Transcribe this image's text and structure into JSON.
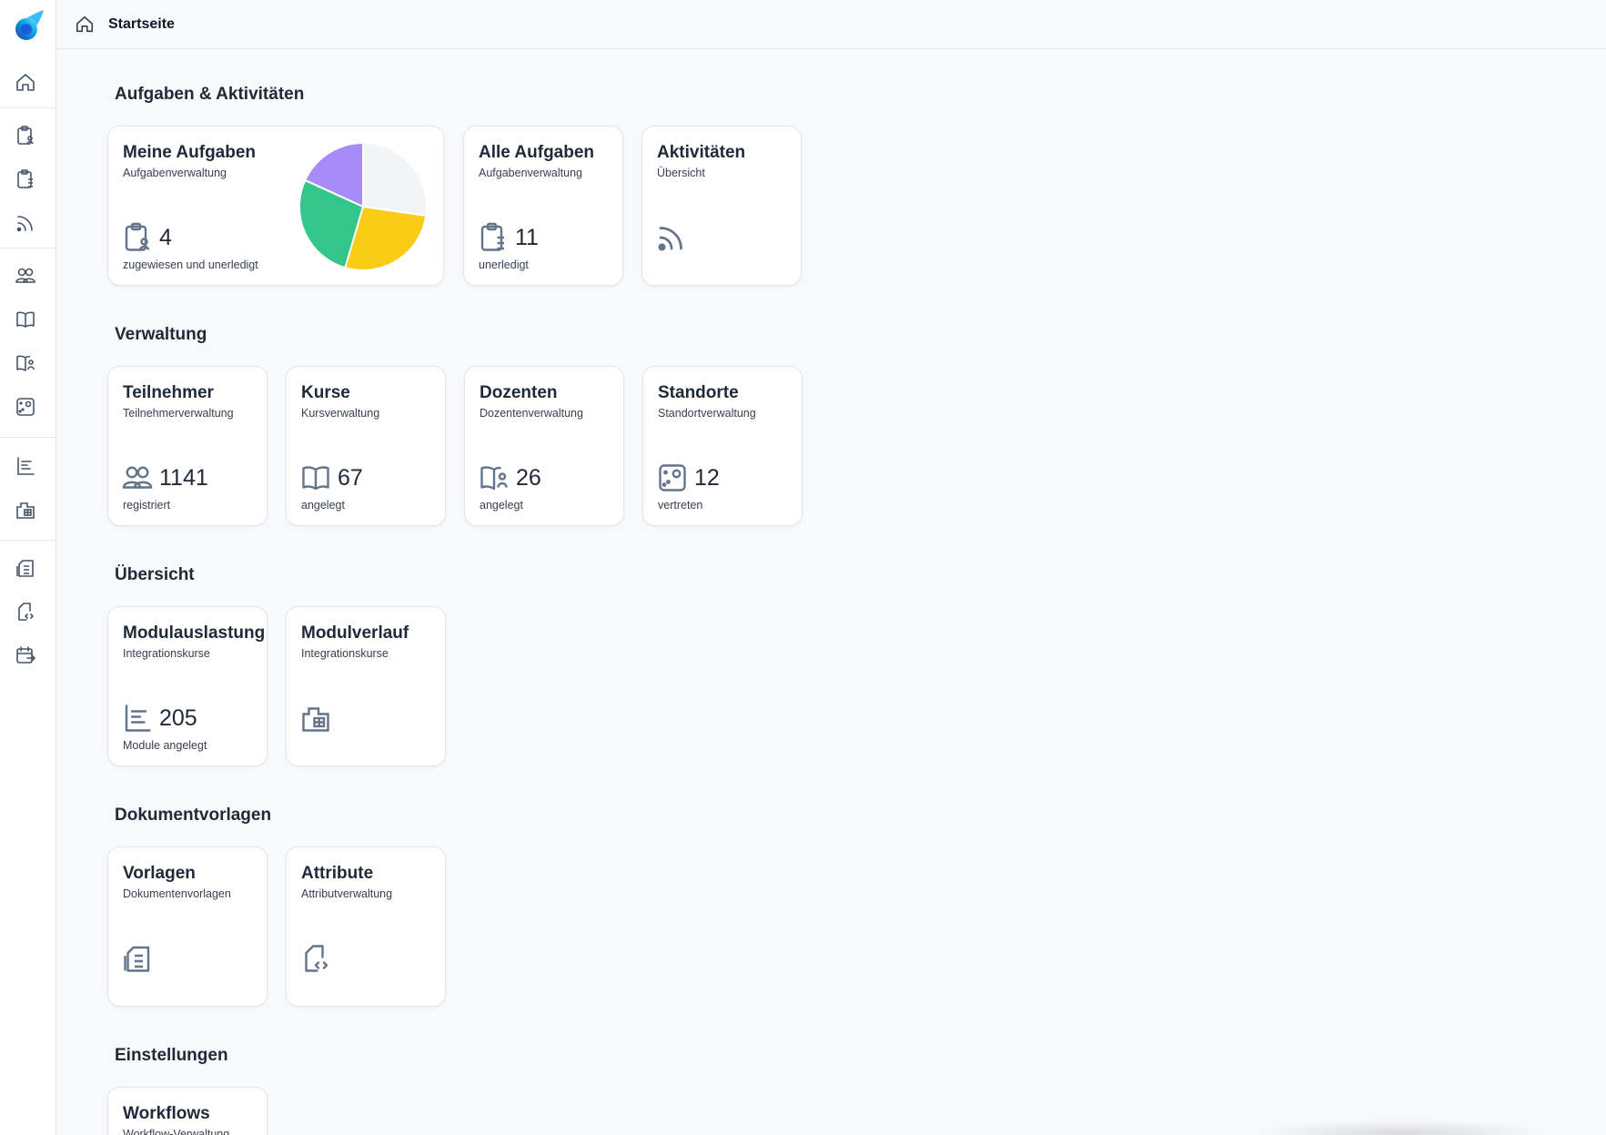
{
  "breadcrumb": {
    "label": "Startseite"
  },
  "sections": {
    "tasks": "Aufgaben & Aktivitäten",
    "admin": "Verwaltung",
    "overview": "Übersicht",
    "templates": "Dokumentvorlagen",
    "settings": "Einstellungen"
  },
  "cards": {
    "my_tasks": {
      "title": "Meine Aufgaben",
      "sub": "Aufgabenverwaltung",
      "value": "4",
      "foot": "zugewiesen und unerledigt",
      "icon": "clipboard-user-icon"
    },
    "all_tasks": {
      "title": "Alle Aufgaben",
      "sub": "Aufgabenverwaltung",
      "value": "11",
      "foot": "unerledigt",
      "icon": "clipboard-list-icon"
    },
    "activities": {
      "title": "Aktivitäten",
      "sub": "Übersicht",
      "icon": "rss-icon"
    },
    "participants": {
      "title": "Teilnehmer",
      "sub": "Teilnehmerverwaltung",
      "value": "1141",
      "foot": "registriert",
      "icon": "users-icon"
    },
    "courses": {
      "title": "Kurse",
      "sub": "Kursverwaltung",
      "value": "67",
      "foot": "angelegt",
      "icon": "book-open-icon"
    },
    "lecturers": {
      "title": "Dozenten",
      "sub": "Dozentenverwaltung",
      "value": "26",
      "foot": "angelegt",
      "icon": "book-user-icon"
    },
    "locations": {
      "title": "Standorte",
      "sub": "Standortverwaltung",
      "value": "12",
      "foot": "vertreten",
      "icon": "map-pin-icon"
    },
    "module_load": {
      "title": "Modulauslastung",
      "sub": "Integrationskurse",
      "value": "205",
      "foot": "Module angelegt",
      "icon": "bar-chart-icon"
    },
    "module_flow": {
      "title": "Modulverlauf",
      "sub": "Integrationskurse",
      "icon": "folder-grid-icon"
    },
    "templates": {
      "title": "Vorlagen",
      "sub": "Dokumentenvorlagen",
      "icon": "documents-icon"
    },
    "attributes": {
      "title": "Attribute",
      "sub": "Attributverwaltung",
      "icon": "file-code-icon"
    },
    "workflows": {
      "title": "Workflows",
      "sub": "Workflow-Verwaltung"
    }
  },
  "sidebar": {
    "items": [
      "home-icon",
      "clipboard-user-icon",
      "clipboard-list-icon",
      "rss-icon",
      "users-icon",
      "book-open-icon",
      "book-user-icon",
      "map-pin-icon",
      "bar-chart-icon",
      "folder-grid-icon",
      "documents-icon",
      "file-code-icon",
      "calendar-arrow-icon"
    ]
  },
  "pie_chart": {
    "type": "pie",
    "slices": [
      {
        "value": 1,
        "color": "#f3f4f6"
      },
      {
        "value": 1,
        "color": "#facc15"
      },
      {
        "value": 1,
        "color": "#34c58a"
      },
      {
        "value": 0.667,
        "color": "#a78bfa"
      }
    ]
  },
  "colors": {
    "icon": "#64748b",
    "accent": "#1d8ff0"
  }
}
